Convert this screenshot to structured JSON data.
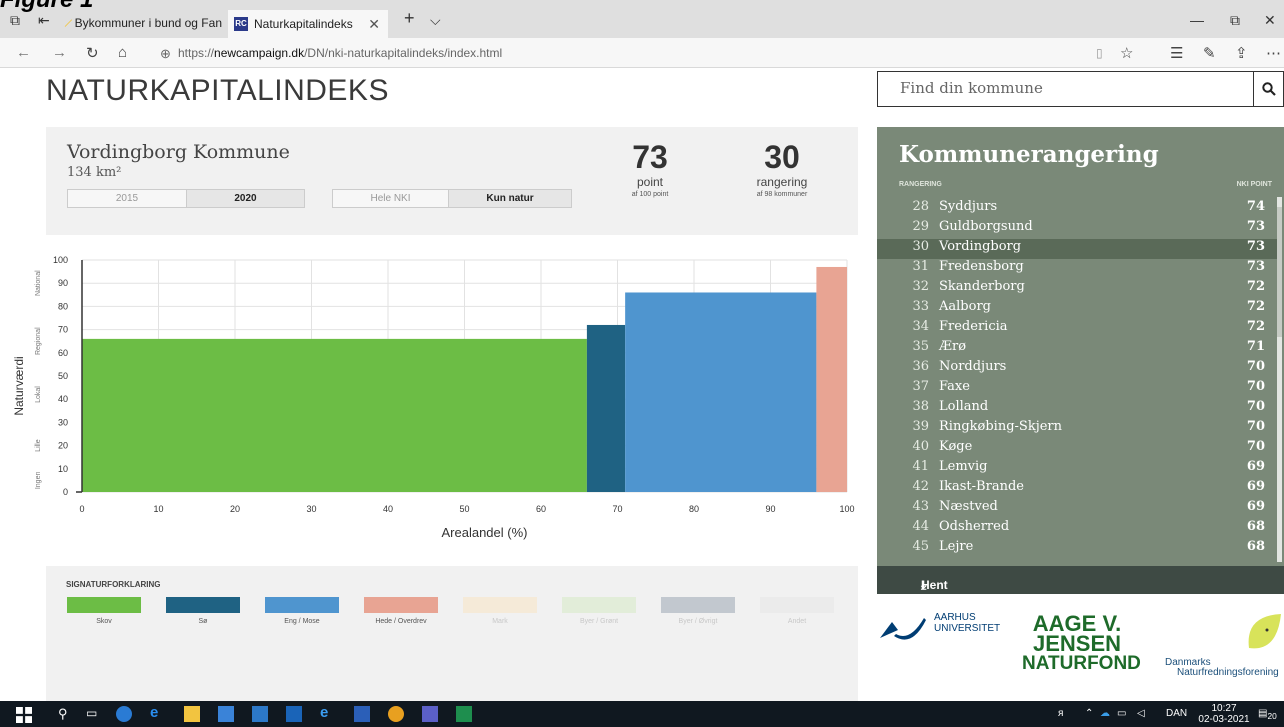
{
  "fragment_title": "Figure 1",
  "browser": {
    "tabs": [
      {
        "title": "Bykommuner i bund og Fan"
      },
      {
        "title": "Naturkapitalindeks"
      }
    ],
    "url_prefix": "https://",
    "url_domain": "newcampaign.dk",
    "url_path": "/DN/nki-naturkapitalindeks/index.html"
  },
  "page": {
    "title": "NATURKAPITALINDEKS",
    "search_placeholder": "Find din kommune"
  },
  "info": {
    "kommune": "Vordingborg Kommune",
    "area": "134 km²",
    "years": [
      "2015",
      "2020"
    ],
    "selected_year": "2020",
    "modes": [
      "Hele NKI",
      "Kun natur"
    ],
    "selected_mode": "Kun natur",
    "points": "73",
    "points_label": "point",
    "points_sub": "af 100 point",
    "rank": "30",
    "rank_label": "rangering",
    "rank_sub": "af 98 kommuner"
  },
  "chart_data": {
    "type": "bar",
    "xlabel": "Arealandel (%)",
    "ylabel": "Naturværdi",
    "xlim": [
      0,
      100
    ],
    "ylim": [
      0,
      100
    ],
    "xticks": [
      "0",
      "10",
      "20",
      "30",
      "40",
      "50",
      "60",
      "70",
      "80",
      "90",
      "100"
    ],
    "yticks": [
      "0",
      "10",
      "20",
      "30",
      "40",
      "50",
      "60",
      "70",
      "80",
      "90",
      "100"
    ],
    "y_categories": [
      "Ingen",
      "Lille",
      "Lokal",
      "Regional",
      "National"
    ],
    "bars": [
      {
        "category": "Skov",
        "x_start": 0,
        "x_end": 66,
        "value": 66,
        "color": "#6cbd45"
      },
      {
        "category": "Sø",
        "x_start": 66,
        "x_end": 71,
        "value": 72,
        "color": "#1f6283"
      },
      {
        "category": "Eng / Mose",
        "x_start": 71,
        "x_end": 96,
        "value": 86,
        "color": "#4f95cf"
      },
      {
        "category": "Hede / Overdrev",
        "x_start": 96,
        "x_end": 100,
        "value": 97,
        "color": "#e8a493"
      }
    ],
    "grid": true
  },
  "legend": {
    "title": "SIGNATURFORKLARING",
    "items": [
      {
        "label": "Skov",
        "color": "#6cbd45"
      },
      {
        "label": "Sø",
        "color": "#1f6283"
      },
      {
        "label": "Eng / Mose",
        "color": "#4f95cf"
      },
      {
        "label": "Hede / Overdrev",
        "color": "#e8a493"
      },
      {
        "label": "Mark",
        "color": "#f5ead8"
      },
      {
        "label": "Byer / Grønt",
        "color": "#e2edd9"
      },
      {
        "label": "Byer / Øvrigt",
        "color": "#c2c8cf"
      },
      {
        "label": "Andet",
        "color": "#ebebeb"
      }
    ]
  },
  "ranking": {
    "title": "Kommunerangering",
    "col_rank": "RANGERING",
    "col_points": "NKI POINT",
    "selected": 30,
    "rows": [
      {
        "rank": "28",
        "name": "Syddjurs",
        "points": "74"
      },
      {
        "rank": "29",
        "name": "Guldborgsund",
        "points": "73"
      },
      {
        "rank": "30",
        "name": "Vordingborg",
        "points": "73"
      },
      {
        "rank": "31",
        "name": "Fredensborg",
        "points": "73"
      },
      {
        "rank": "32",
        "name": "Skanderborg",
        "points": "72"
      },
      {
        "rank": "33",
        "name": "Aalborg",
        "points": "72"
      },
      {
        "rank": "34",
        "name": "Fredericia",
        "points": "72"
      },
      {
        "rank": "35",
        "name": "Ærø",
        "points": "71"
      },
      {
        "rank": "36",
        "name": "Norddjurs",
        "points": "70"
      },
      {
        "rank": "37",
        "name": "Faxe",
        "points": "70"
      },
      {
        "rank": "38",
        "name": "Lolland",
        "points": "70"
      },
      {
        "rank": "39",
        "name": "Ringkøbing-Skjern",
        "points": "70"
      },
      {
        "rank": "40",
        "name": "Køge",
        "points": "70"
      },
      {
        "rank": "41",
        "name": "Lemvig",
        "points": "69"
      },
      {
        "rank": "42",
        "name": "Ikast-Brande",
        "points": "69"
      },
      {
        "rank": "43",
        "name": "Næstved",
        "points": "69"
      },
      {
        "rank": "44",
        "name": "Odsherred",
        "points": "68"
      },
      {
        "rank": "45",
        "name": "Lejre",
        "points": "68"
      }
    ],
    "download_label": "Hent indeks"
  },
  "logos": {
    "au_line1": "AARHUS",
    "au_line2": "UNIVERSITET",
    "aage_line1": "AAGE V.",
    "aage_line2": "JENSEN",
    "aage_line3": "NATURFOND",
    "dn_line1": "Danmarks",
    "dn_line2": "Naturfredningsforening"
  },
  "taskbar": {
    "language": "DAN",
    "time": "10:27",
    "date": "02-03-2021",
    "notification_count": "20"
  }
}
